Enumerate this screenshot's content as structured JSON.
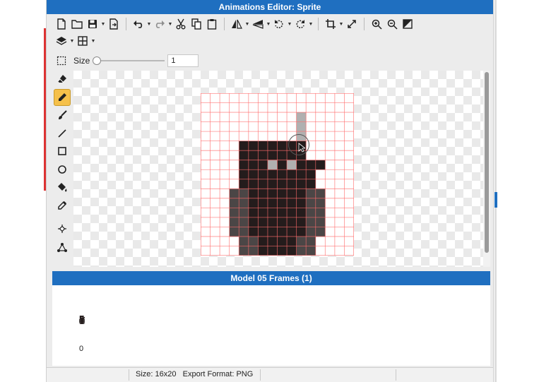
{
  "window": {
    "title": "Animations Editor: Sprite"
  },
  "toolbar": {
    "icons": [
      "new-file-icon",
      "open-folder-icon",
      "save-icon",
      "export-icon",
      "undo-icon",
      "redo-icon",
      "cut-icon",
      "copy-icon",
      "paste-icon",
      "flip-horizontal-icon",
      "flip-vertical-icon",
      "rotate-left-icon",
      "rotate-right-icon",
      "crop-icon",
      "resize-icon",
      "zoom-in-icon",
      "zoom-out-icon",
      "invert-icon",
      "layers-icon",
      "grid-icon"
    ]
  },
  "brush": {
    "size_label": "Size",
    "size_value": "1",
    "slider_fraction": 0.0
  },
  "tools": [
    "select-icon",
    "eraser-icon",
    "pencil-icon",
    "brush-icon",
    "line-icon",
    "rectangle-icon",
    "ellipse-icon",
    "fill-bucket-icon",
    "eyedropper-icon",
    "move-point-icon",
    "node-icon"
  ],
  "active_tool": "pencil-icon",
  "canvas": {
    "grid_cols": 16,
    "grid_rows": 17,
    "grid_color": "#ff6b6b",
    "colors": {
      "dark": "#241c1c",
      "mid": "#4b4646",
      "light": "#b0b0b0"
    },
    "pixels": [
      "................",
      "................",
      "..........l.....",
      "..........l.....",
      "..........l.....",
      "....ddddddd.....",
      "....ddddddd.....",
      "....dddldlddd...",
      "....dddddddd....",
      "....dddddddd....",
      "...mmddddddmm...",
      "...mmddddddmm...",
      "...mmddddddmm...",
      "...mmddddddmm...",
      "...mmddddddmm...",
      "....mmddddmm....",
      "....mmddddmm...."
    ]
  },
  "frames_panel": {
    "title": "Model 05 Frames (1)",
    "frames": [
      {
        "index": "0"
      }
    ]
  },
  "status": {
    "size": "Size: 16x20",
    "export_format": "Export Format: PNG"
  }
}
